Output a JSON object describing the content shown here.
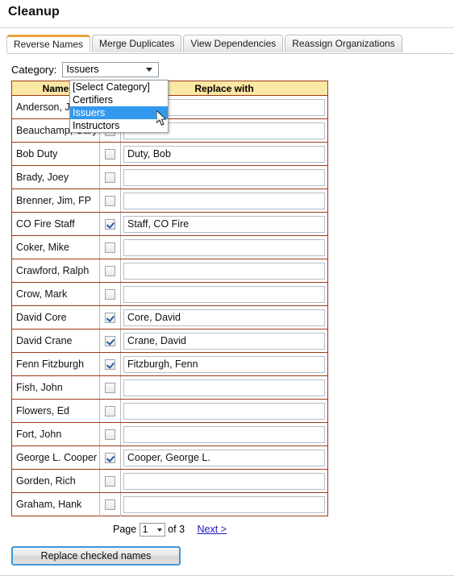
{
  "page": {
    "title": "Cleanup"
  },
  "tabs": [
    {
      "label": "Reverse Names",
      "active": true
    },
    {
      "label": "Merge Duplicates",
      "active": false
    },
    {
      "label": "View Dependencies",
      "active": false
    },
    {
      "label": "Reassign Organizations",
      "active": false
    }
  ],
  "category": {
    "label": "Category:",
    "selected": "Issuers",
    "options": [
      "[Select Category]",
      "Certifiers",
      "Issuers",
      "Instructors"
    ],
    "highlighted": "Issuers",
    "expanded": true,
    "arrow_icon": "chevron-down-icon"
  },
  "table": {
    "headers": [
      "Name",
      "",
      "Replace with"
    ],
    "rows": [
      {
        "name": "Anderson, Joe",
        "checked": false,
        "replace_with": ""
      },
      {
        "name": "Beauchamp, Gary",
        "checked": false,
        "replace_with": ""
      },
      {
        "name": "Bob Duty",
        "checked": false,
        "replace_with": "Duty, Bob"
      },
      {
        "name": "Brady, Joey",
        "checked": false,
        "replace_with": ""
      },
      {
        "name": "Brenner, Jim, FP",
        "checked": false,
        "replace_with": ""
      },
      {
        "name": "CO Fire Staff",
        "checked": true,
        "replace_with": "Staff, CO Fire"
      },
      {
        "name": "Coker, Mike",
        "checked": false,
        "replace_with": ""
      },
      {
        "name": "Crawford, Ralph",
        "checked": false,
        "replace_with": ""
      },
      {
        "name": "Crow, Mark",
        "checked": false,
        "replace_with": ""
      },
      {
        "name": "David Core",
        "checked": true,
        "replace_with": "Core, David"
      },
      {
        "name": "David Crane",
        "checked": true,
        "replace_with": "Crane, David"
      },
      {
        "name": "Fenn Fitzburgh",
        "checked": true,
        "replace_with": "Fitzburgh, Fenn"
      },
      {
        "name": "Fish, John",
        "checked": false,
        "replace_with": ""
      },
      {
        "name": "Flowers, Ed",
        "checked": false,
        "replace_with": ""
      },
      {
        "name": "Fort, John",
        "checked": false,
        "replace_with": ""
      },
      {
        "name": "George L. Cooper",
        "checked": true,
        "replace_with": "Cooper, George L."
      },
      {
        "name": "Gorden, Rich",
        "checked": false,
        "replace_with": ""
      },
      {
        "name": "Graham, Hank",
        "checked": false,
        "replace_with": ""
      }
    ]
  },
  "pager": {
    "page_label": "Page",
    "current_page": "1",
    "of_label": "of 3",
    "next_label": "Next >",
    "arrow_icon": "chevron-down-icon"
  },
  "actions": {
    "replace_button": "Replace checked names"
  },
  "colors": {
    "active_tab_accent": "#e8a33d",
    "table_border": "#9e3a18",
    "table_header_bg": "#fbe8a4",
    "dropdown_highlight": "#3399ef",
    "link": "#1818b8",
    "button_focus": "#3e9ad6"
  }
}
